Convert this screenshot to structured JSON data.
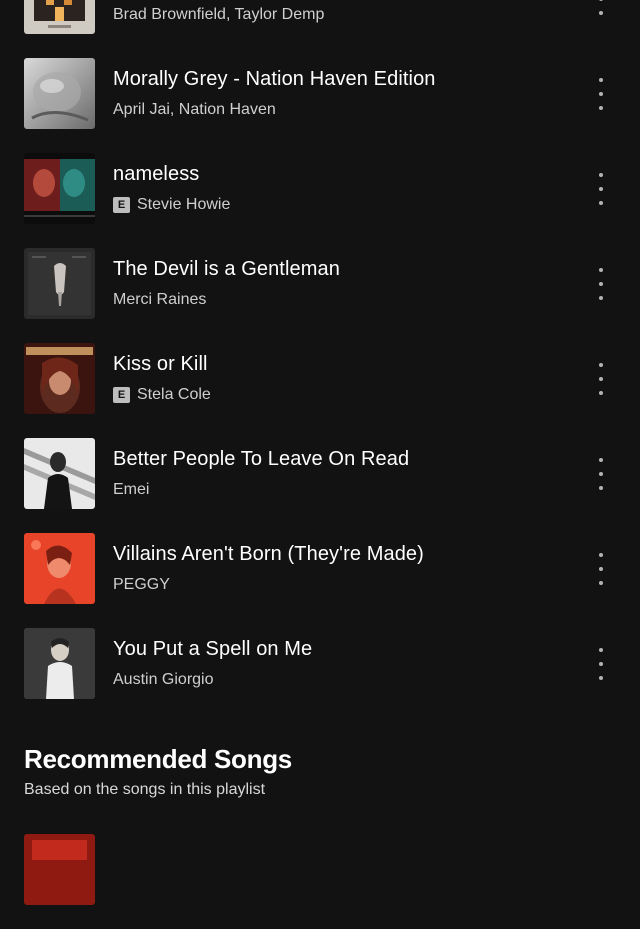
{
  "tracks": [
    {
      "title": "",
      "artist": "Brad Brownfield, Taylor Demp",
      "explicit": false,
      "cover_icon": "album-cover-house"
    },
    {
      "title": "Morally Grey - Nation Haven Edition",
      "artist": "April Jai, Nation Haven",
      "explicit": false,
      "cover_icon": "album-cover-grey"
    },
    {
      "title": "nameless",
      "artist": "Stevie Howie",
      "explicit": true,
      "explicit_label": "E",
      "cover_icon": "album-cover-nameless"
    },
    {
      "title": "The Devil is a Gentleman",
      "artist": "Merci Raines",
      "explicit": false,
      "cover_icon": "album-cover-devil"
    },
    {
      "title": "Kiss or Kill",
      "artist": "Stela Cole",
      "explicit": true,
      "explicit_label": "E",
      "cover_icon": "album-cover-kiss-or-kill"
    },
    {
      "title": "Better People To Leave On Read",
      "artist": "Emei",
      "explicit": false,
      "cover_icon": "album-cover-emei"
    },
    {
      "title": "Villains Aren't Born (They're Made)",
      "artist": "PEGGY",
      "explicit": false,
      "cover_icon": "album-cover-villains"
    },
    {
      "title": "You Put a Spell on Me",
      "artist": "Austin Giorgio",
      "explicit": false,
      "cover_icon": "album-cover-spell"
    }
  ],
  "recommended": {
    "title": "Recommended Songs",
    "subtitle": "Based on the songs in this playlist"
  },
  "colors": {
    "background": "#121212",
    "primary_text": "#ffffff",
    "secondary_text": "#b3b3b3"
  }
}
